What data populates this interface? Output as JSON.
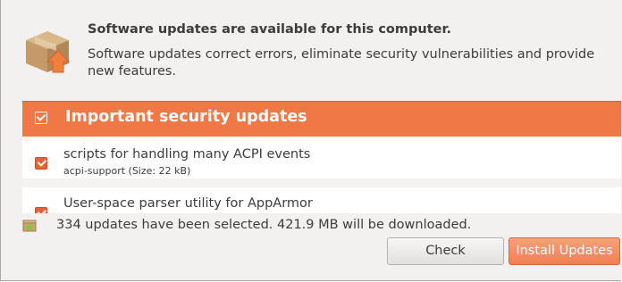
{
  "header": {
    "title": "Software updates are available for this computer.",
    "description": "Software updates correct errors, eliminate security vulnerabilities and provide new features."
  },
  "updates": {
    "group": {
      "label": "Important security updates",
      "checked": true
    },
    "items": [
      {
        "title": "scripts for handling many ACPI events",
        "subtitle": "acpi-support (Size: 22 kB)",
        "checked": true
      },
      {
        "title": "User-space parser utility for AppArmor",
        "subtitle": "",
        "checked": true
      }
    ]
  },
  "status": {
    "text": "334 updates have been selected. 421.9 MB will be downloaded."
  },
  "buttons": {
    "check_label": "Check",
    "install_label": "Install Updates"
  },
  "colors": {
    "accent": "#f07746",
    "checkbox": "#e8613a",
    "background": "#f2f1f0"
  },
  "icons": {
    "header": "package-update-icon",
    "status": "package-icon"
  }
}
